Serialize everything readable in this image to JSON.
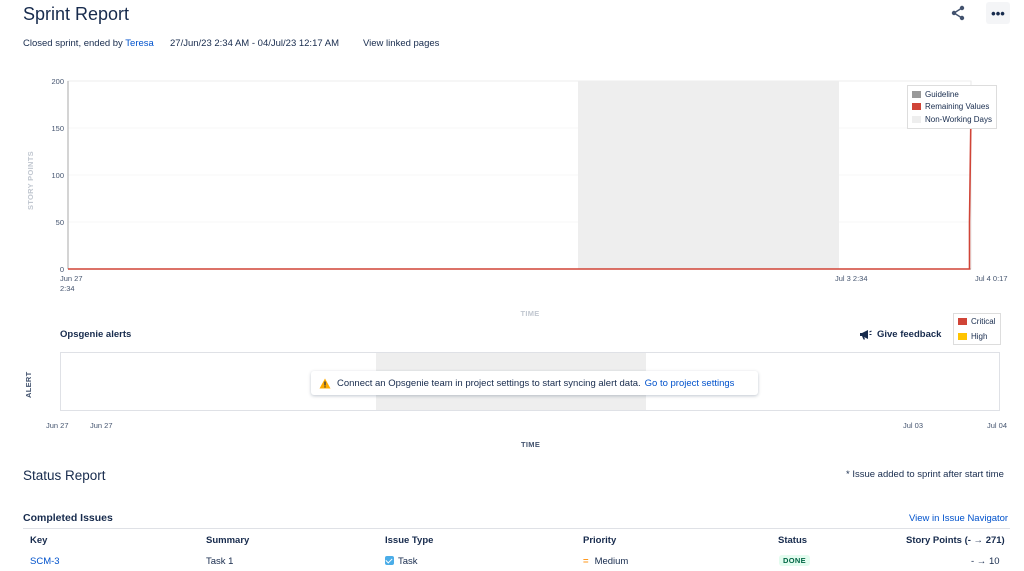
{
  "header": {
    "title": "Sprint Report",
    "meta_prefix": "Closed sprint, ended by",
    "user": "Teresa",
    "date_range": "27/Jun/23 2:34 AM - 04/Jul/23 12:17 AM",
    "view_linked": "View linked pages",
    "more_label": "•••"
  },
  "burndown": {
    "ylabel": "STORY POINTS",
    "xlabel": "TIME",
    "y_ticks": [
      "200",
      "150",
      "100",
      "50",
      "0"
    ],
    "x_tick_start_line1": "Jun 27",
    "x_tick_start_line2": "2:34",
    "x_tick_mid": "Jul 3 2:34",
    "x_tick_end": "Jul 4 0:17",
    "legend": {
      "guideline": "Guideline",
      "remaining": "Remaining Values",
      "nonworking": "Non-Working Days"
    },
    "colors": {
      "guideline": "#999999",
      "remaining": "#d04437",
      "nonworking": "#eeeeee"
    }
  },
  "chart_data": {
    "type": "line",
    "ylabel": "STORY POINTS",
    "xlabel": "TIME",
    "ylim": [
      0,
      200
    ],
    "x_range": [
      "Jun 27 2:34",
      "Jul 4 0:17"
    ],
    "non_working_period": [
      "Jul 1",
      "Jul 3"
    ],
    "series": [
      {
        "name": "Remaining Values",
        "x": [
          "Jun 27 2:34",
          "Jul 4 0:00",
          "Jul 4 0:00",
          "Jul 4 0:17"
        ],
        "values": [
          0,
          0,
          50,
          170
        ]
      }
    ],
    "legend": "top-right"
  },
  "opsgenie": {
    "title": "Opsgenie alerts",
    "feedback": "Give feedback",
    "ylabel": "ALERT",
    "xlabel": "TIME",
    "legend": {
      "critical": "Critical",
      "high": "High"
    },
    "colors": {
      "critical": "#d04437",
      "high": "#ffc400"
    },
    "message": "Connect an Opsgenie team in project settings to start syncing alert data.",
    "message_link": "Go to project settings",
    "x_ticks": {
      "a": "Jun 27",
      "b": "Jun 27",
      "c": "Jul 03",
      "d": "Jul 04"
    }
  },
  "status": {
    "title": "Status Report",
    "note": "* Issue added to sprint after start time",
    "completed_title": "Completed Issues",
    "navigator_link": "View in Issue Navigator",
    "columns": {
      "key": "Key",
      "summary": "Summary",
      "type": "Issue Type",
      "priority": "Priority",
      "status": "Status",
      "points": "Story Points (- → 271)"
    },
    "rows": [
      {
        "key": "SCM-3",
        "summary": "Task 1",
        "type": "Task",
        "priority": "Medium",
        "status": "DONE",
        "points": "- → 10"
      }
    ]
  }
}
